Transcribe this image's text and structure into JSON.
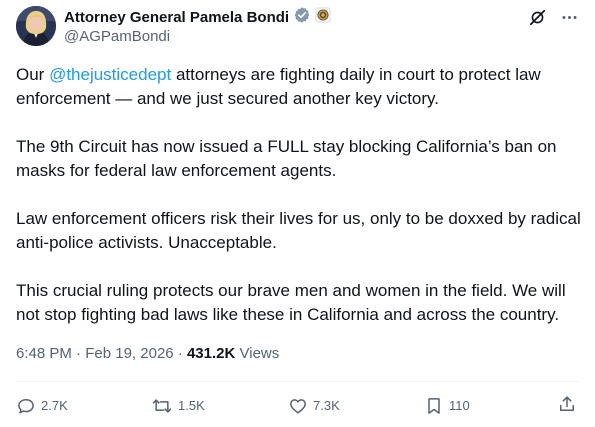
{
  "author": {
    "display_name": "Attorney General Pamela Bondi",
    "handle": "@AGPamBondi"
  },
  "post": {
    "p1_before": "Our ",
    "p1_mention": "@thejusticedept",
    "p1_after": " attorneys are fighting daily in court to protect law enforcement — and we just secured another key victory.",
    "p2": "The 9th Circuit has now issued a FULL stay blocking California’s ban on masks for federal law enforcement agents.",
    "p3": "Law enforcement officers risk their lives for us, only to be doxxed by radical anti-police activists. Unacceptable.",
    "p4": "This crucial ruling protects our brave men and women in the field. We will not stop fighting bad laws like these in California and across the country."
  },
  "meta": {
    "time": "6:48 PM",
    "separator1": " · ",
    "date": "Feb 19, 2026",
    "separator2": " · ",
    "views_count": "431.2K",
    "views_label": " Views"
  },
  "actions": {
    "replies": "2.7K",
    "reposts": "1.5K",
    "likes": "7.3K",
    "bookmarks": "110"
  },
  "colors": {
    "text": "#0f1419",
    "secondary": "#536471",
    "link": "#1d9bf0",
    "verified_badge": "#829aab",
    "divider": "#eff3f4"
  },
  "icons": {
    "verified": "verified-badge-icon",
    "affiliate": "affiliate-seal-icon",
    "grok": "grok-icon",
    "more": "more-icon",
    "reply": "reply-icon",
    "repost": "repost-icon",
    "like": "like-icon",
    "bookmark": "bookmark-icon",
    "share": "share-icon"
  }
}
